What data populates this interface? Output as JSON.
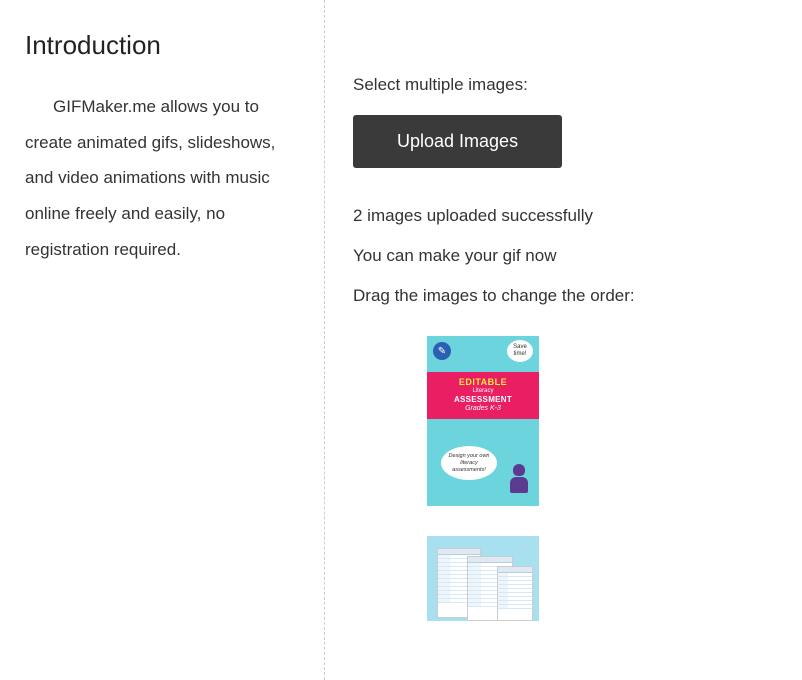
{
  "intro": {
    "heading": "Introduction",
    "paragraph": "GIFMaker.me allows you to create animated gifs, slideshows, and video animations with music online freely and easily, no registration required."
  },
  "upload": {
    "select_label": "Select multiple images:",
    "button_label": "Upload Images",
    "status_count": "2 images uploaded successfully",
    "status_ready": "You can make your gif now",
    "drag_label": "Drag the images to change the order:"
  },
  "thumb1": {
    "bubble_top": "Save time!",
    "line1": "EDITABLE",
    "line2": "Literacy",
    "line3": "ASSESSMENT",
    "line4": "Grades K-3",
    "bubble_bot": "Design your own literacy assessments!"
  }
}
